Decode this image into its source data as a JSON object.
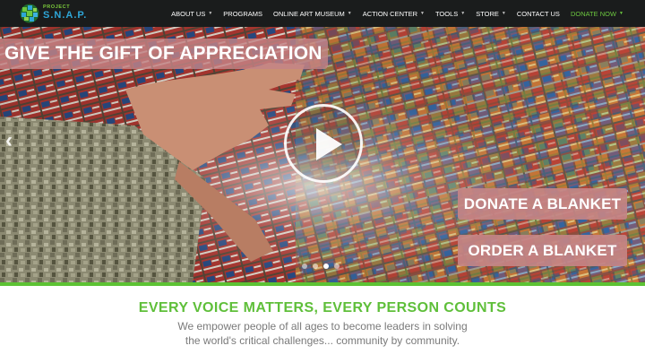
{
  "brand": {
    "logo_small": "PROJECT",
    "logo_big": "S.N.A.P.",
    "colors": {
      "green": "#5cc233",
      "blue": "#2ea6d8",
      "pink": "#c48486"
    }
  },
  "nav": [
    {
      "label": "ABOUT US",
      "dropdown": true
    },
    {
      "label": "PROGRAMS",
      "dropdown": false
    },
    {
      "label": "ONLINE ART MUSEUM",
      "dropdown": true
    },
    {
      "label": "ACTION CENTER",
      "dropdown": true
    },
    {
      "label": "TOOLS",
      "dropdown": true
    },
    {
      "label": "STORE",
      "dropdown": true
    },
    {
      "label": "CONTACT US",
      "dropdown": false
    },
    {
      "label": "DONATE NOW",
      "dropdown": true
    }
  ],
  "hero": {
    "headline": "GIVE THE GIFT OF APPRECIATION",
    "donate_button": "DONATE A BLANKET",
    "order_button": "ORDER A BLANKET",
    "slide_count": 4,
    "active_slide": 3
  },
  "tagline": {
    "title": "EVERY VOICE MATTERS, EVERY PERSON COUNTS",
    "line1": "We empower people of all ages to become leaders in solving",
    "line2": "the world's critical challenges... community by community."
  }
}
